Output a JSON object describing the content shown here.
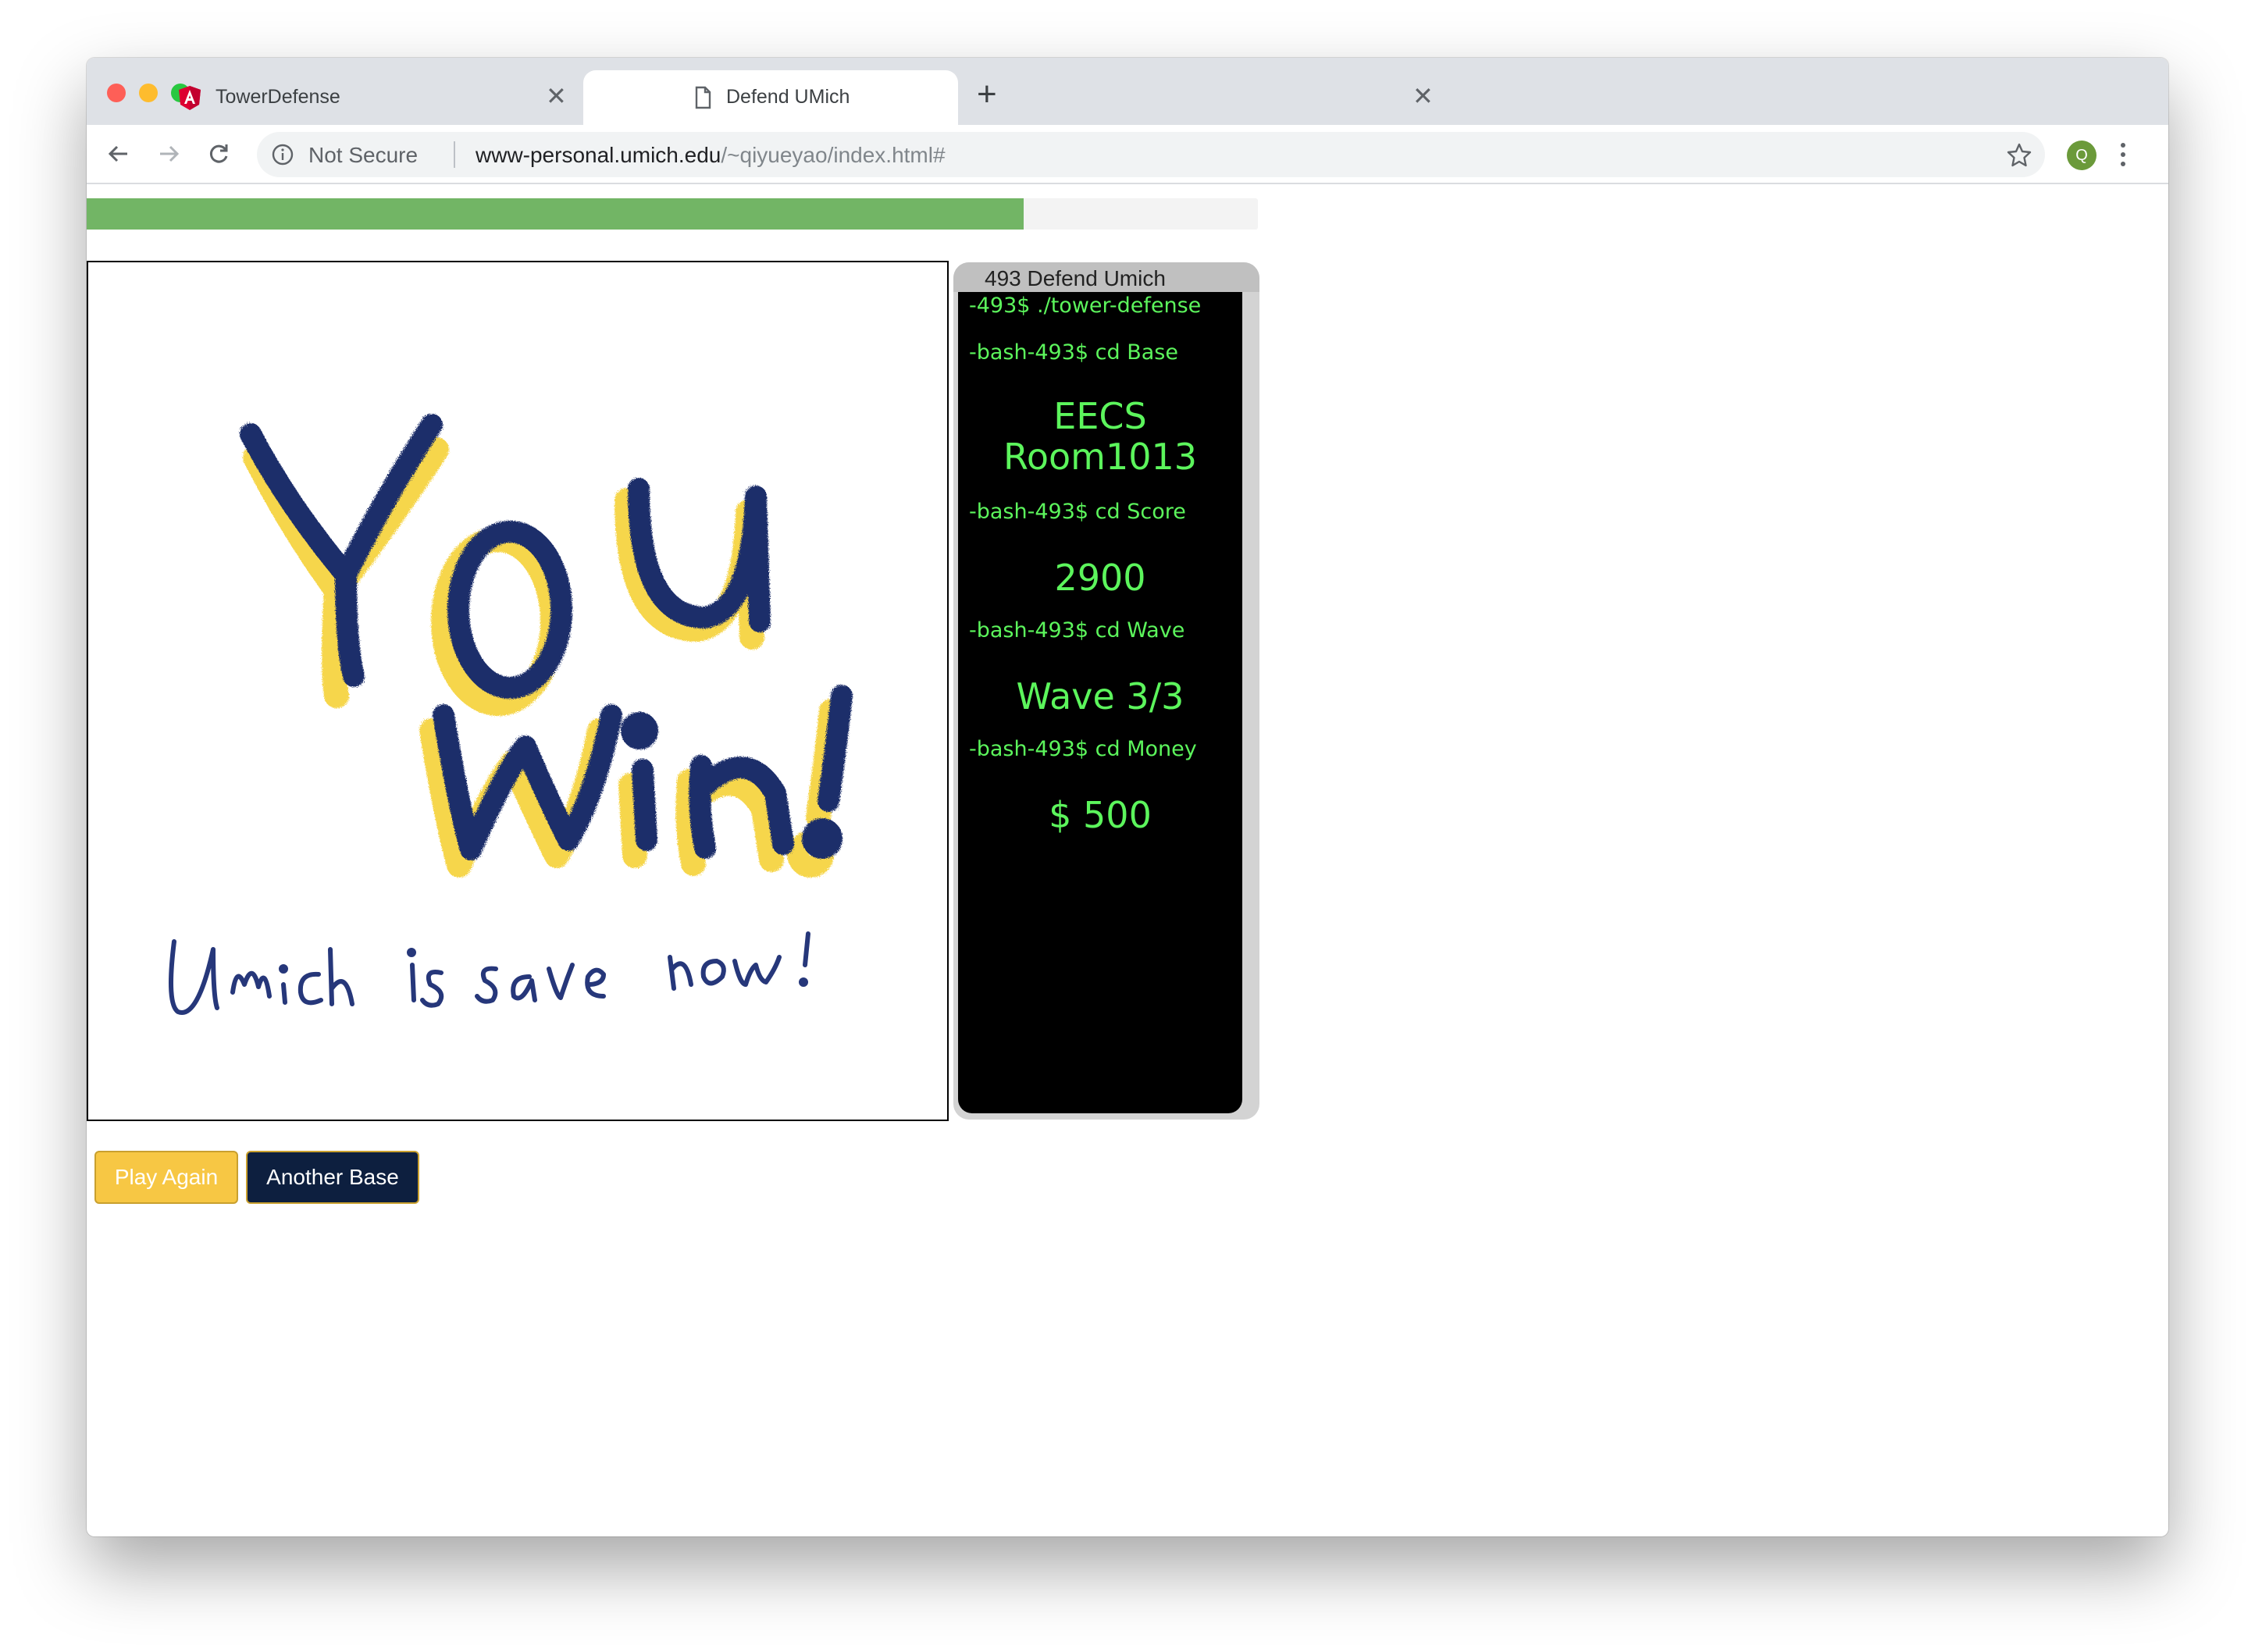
{
  "browser": {
    "tabs": [
      {
        "title": "TowerDefense",
        "icon": "angular-icon",
        "active": false
      },
      {
        "title": "Defend UMich",
        "icon": "document-icon",
        "active": true
      }
    ],
    "new_tab_label": "+",
    "omnibox": {
      "security_label": "Not Secure",
      "url_domain": "www-personal.umich.edu",
      "url_path": "/~qiyueyao/index.html#"
    },
    "avatar_letter": "Q",
    "close_glyph": "✕"
  },
  "game": {
    "progress": 0.8,
    "progress_color": "#72b565",
    "canvas_image": "you-win-handwritten",
    "canvas_text": [
      "You",
      "Win!",
      "Umich is save now!"
    ],
    "ink_colors": {
      "navy": "#1f2f6b",
      "yellow": "#f6d443"
    }
  },
  "terminal": {
    "title": "493 Defend Umich",
    "text_color": "#5cf55c",
    "lines": [
      {
        "cmd": "-493$ ./tower-defense"
      },
      {
        "cmd": "-bash-493$ cd Base",
        "value": [
          "EECS",
          "Room1013"
        ]
      },
      {
        "cmd": "-bash-493$ cd Score",
        "value": [
          "2900"
        ]
      },
      {
        "cmd": "-bash-493$ cd Wave",
        "value": [
          "Wave 3/3"
        ]
      },
      {
        "cmd": "-bash-493$ cd Money",
        "value": [
          "$ 500"
        ]
      }
    ]
  },
  "buttons": {
    "play_again": "Play Again",
    "another_base": "Another Base",
    "play_color": "#f7c744",
    "base_color": "#0d1f3f"
  }
}
